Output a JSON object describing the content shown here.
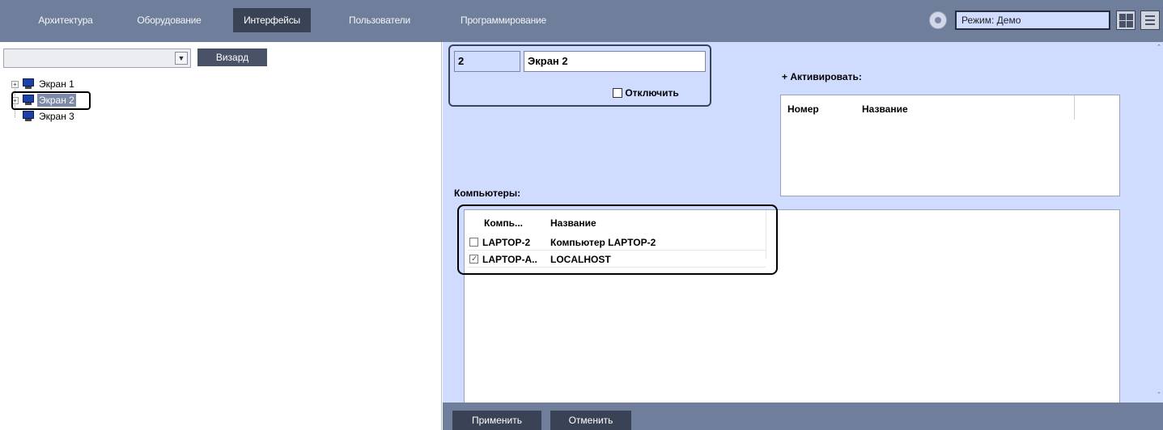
{
  "menu": {
    "tabs": [
      {
        "label": "Архитектура"
      },
      {
        "label": "Оборудование"
      },
      {
        "label": "Интерфейсы"
      },
      {
        "label": "Пользователи"
      },
      {
        "label": "Программирование"
      }
    ],
    "active_tab": "Интерфейсы",
    "mode_field": "Режим: Демо"
  },
  "left_panel": {
    "object_select_value": "",
    "wizard_label": "Визард",
    "tree": [
      {
        "label": "Экран 1",
        "expandable": true,
        "selected": false
      },
      {
        "label": "Экран 2",
        "expandable": true,
        "selected": true
      },
      {
        "label": "Экран 3",
        "expandable": false,
        "selected": false
      }
    ]
  },
  "settings": {
    "screen_number": "2",
    "screen_name": "Экран 2",
    "disable_label": "Отключить",
    "disable_checked": false,
    "activate_label": "+ Активировать:",
    "activate_table": {
      "headers": [
        "Номер",
        "Название"
      ],
      "rows": []
    },
    "computers_label": "Компьютеры:",
    "computers_table": {
      "headers": [
        "Компь...",
        "Название"
      ],
      "rows": [
        {
          "checked": false,
          "computer": "LAPTOP-2",
          "name": "Компьютер LAPTOP-2"
        },
        {
          "checked": true,
          "computer": "LAPTOP-A..",
          "name": "LOCALHOST"
        }
      ]
    }
  },
  "footer": {
    "apply_label": "Применить",
    "cancel_label": "Отменить"
  },
  "colors": {
    "menu_bar": "#6f7f9b",
    "active_tab": "#3a4255",
    "panel_bg": "#cfdcff",
    "tree_selected": "#7d8aa7"
  }
}
